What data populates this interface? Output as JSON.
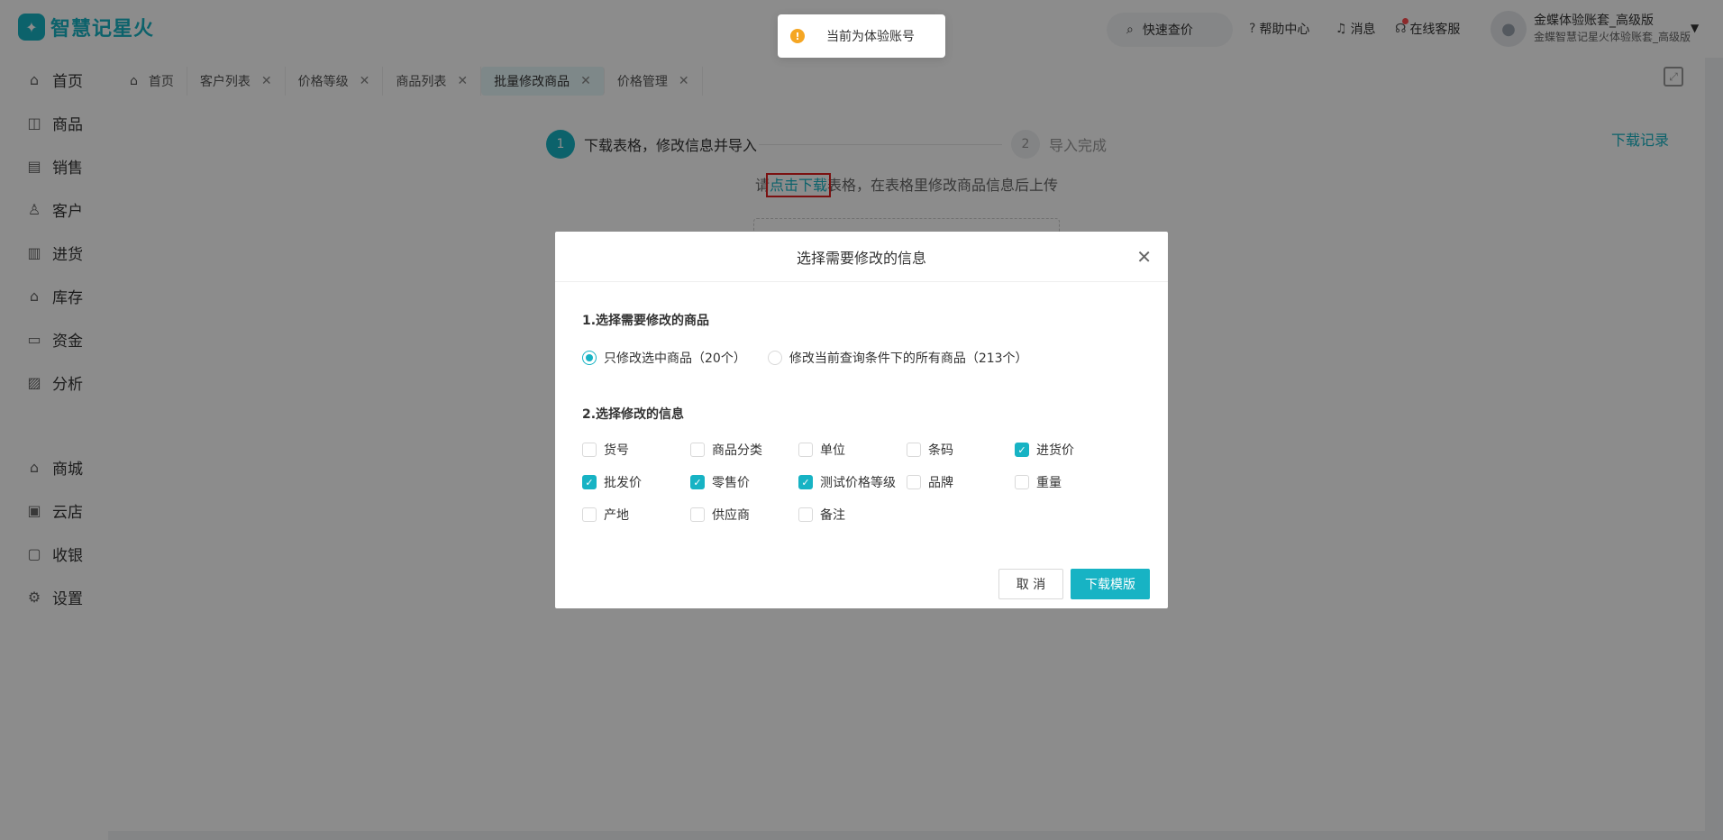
{
  "app": {
    "name": "智慧记星火",
    "logo_icon": "bird-logo"
  },
  "header": {
    "quick_search": "快速查价",
    "help": "帮助中心",
    "messages": "消息",
    "support": "在线客服",
    "user": {
      "name": "金蝶体验账套_高级版",
      "sub": "金蝶智慧记星火体验账套_高级版"
    }
  },
  "toast": {
    "text": "当前为体验账号"
  },
  "sidebar": {
    "items": [
      {
        "label": "首页",
        "icon": "home-icon"
      },
      {
        "label": "商品",
        "icon": "bag-icon"
      },
      {
        "label": "销售",
        "icon": "clipboard-icon"
      },
      {
        "label": "客户",
        "icon": "user-icon"
      },
      {
        "label": "进货",
        "icon": "inbox-icon"
      },
      {
        "label": "库存",
        "icon": "warehouse-icon"
      },
      {
        "label": "资金",
        "icon": "folder-icon"
      },
      {
        "label": "分析",
        "icon": "chart-icon"
      },
      {
        "label": "商城",
        "icon": "shop-icon"
      },
      {
        "label": "云店",
        "icon": "store-icon"
      },
      {
        "label": "收银",
        "icon": "cashier-icon"
      },
      {
        "label": "设置",
        "icon": "gear-icon"
      }
    ]
  },
  "tabs": [
    {
      "label": "首页"
    },
    {
      "label": "客户列表"
    },
    {
      "label": "价格等级"
    },
    {
      "label": "商品列表"
    },
    {
      "label": "批量修改商品"
    },
    {
      "label": "价格管理"
    }
  ],
  "steps": {
    "step1_num": "1",
    "step1": "下载表格，修改信息并导入",
    "step2_num": "2",
    "step2": "导入完成"
  },
  "download_record": "下载记录",
  "instruction": {
    "pre": "请",
    "link": "点击下载",
    "post": "表格，在表格里修改商品信息后上传"
  },
  "modal": {
    "title": "选择需要修改的信息",
    "section1": "1.选择需要修改的商品",
    "radio_selected": "只修改选中商品（20个）",
    "radio_all": "修改当前查询条件下的所有商品（213个）",
    "section2": "2.选择修改的信息",
    "fields": [
      {
        "label": "货号",
        "checked": false
      },
      {
        "label": "商品分类",
        "checked": false
      },
      {
        "label": "单位",
        "checked": false
      },
      {
        "label": "条码",
        "checked": false
      },
      {
        "label": "进货价",
        "checked": true
      },
      {
        "label": "批发价",
        "checked": true
      },
      {
        "label": "零售价",
        "checked": true
      },
      {
        "label": "测试价格等级",
        "checked": true
      },
      {
        "label": "品牌",
        "checked": false
      },
      {
        "label": "重量",
        "checked": false
      },
      {
        "label": "产地",
        "checked": false
      },
      {
        "label": "供应商",
        "checked": false
      },
      {
        "label": "备注",
        "checked": false
      }
    ],
    "cancel": "取 消",
    "confirm": "下载模版"
  },
  "colors": {
    "accent": "#17b3c4",
    "highlight": "#e02020"
  }
}
